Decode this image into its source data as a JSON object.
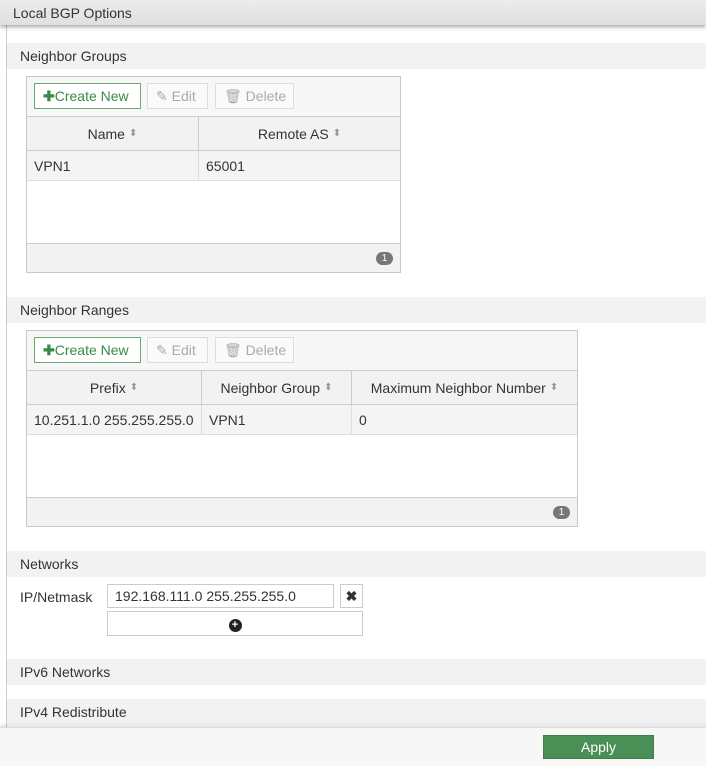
{
  "header": {
    "title": "Local BGP Options"
  },
  "toolbar": {
    "create": "Create New",
    "edit": "Edit",
    "delete": "Delete"
  },
  "neighbor_groups": {
    "title": "Neighbor Groups",
    "columns": [
      "Name",
      "Remote AS"
    ],
    "rows": [
      [
        "VPN1",
        "65001"
      ]
    ],
    "count": "1"
  },
  "neighbor_ranges": {
    "title": "Neighbor Ranges",
    "columns": [
      "Prefix",
      "Neighbor Group",
      "Maximum Neighbor Number"
    ],
    "rows": [
      [
        "10.251.1.0 255.255.255.0",
        "VPN1",
        "0"
      ]
    ],
    "count": "1"
  },
  "networks": {
    "title": "Networks",
    "label": "IP/Netmask",
    "value": "192.168.111.0 255.255.255.0"
  },
  "ipv6": {
    "title": "IPv6 Networks"
  },
  "ipv4_redistribute": {
    "title": "IPv4 Redistribute"
  },
  "footer": {
    "apply": "Apply"
  }
}
